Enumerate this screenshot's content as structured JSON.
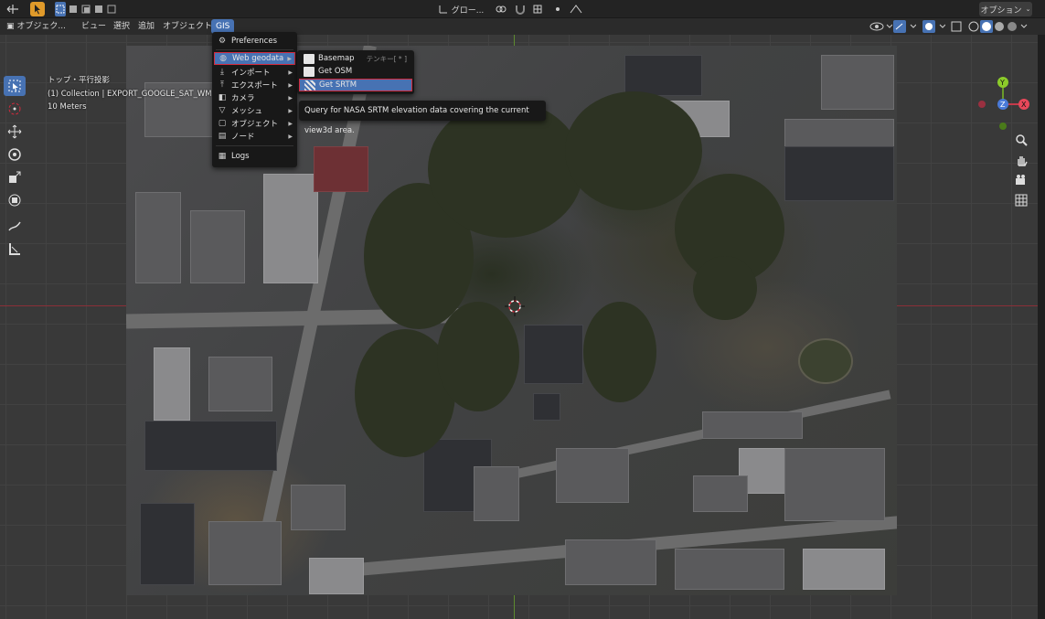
{
  "topbar": {
    "mode_icon": "object-mode-icon",
    "orientation_label": "グロー...",
    "options_label": "オプション"
  },
  "header": {
    "menus": [
      "オブジェク...",
      "ビュー",
      "選択",
      "追加",
      "オブジェクト",
      "GIS"
    ]
  },
  "viewport": {
    "view_name": "トップ・平行投影",
    "collection": "(1) Collection | EXPORT_GOOGLE_SAT_WM",
    "scale": "10 Meters"
  },
  "gis_menu": {
    "items": [
      {
        "label": "Preferences",
        "icon": "gear-icon",
        "submenu": false
      },
      {
        "label": "Web geodata",
        "icon": "globe-icon",
        "submenu": true
      },
      {
        "label": "インポート",
        "icon": "import-icon",
        "submenu": true
      },
      {
        "label": "エクスポート",
        "icon": "export-icon",
        "submenu": true
      },
      {
        "label": "カメラ",
        "icon": "camera-icon",
        "submenu": true
      },
      {
        "label": "メッシュ",
        "icon": "mesh-icon",
        "submenu": true
      },
      {
        "label": "オブジェクト",
        "icon": "object-icon",
        "submenu": true
      },
      {
        "label": "ノード",
        "icon": "node-icon",
        "submenu": true
      },
      {
        "label": "Logs",
        "icon": "log-icon",
        "submenu": false
      }
    ]
  },
  "web_geodata_menu": {
    "items": [
      {
        "label": "Basemap",
        "shortcut": "テンキー[ * ]"
      },
      {
        "label": "Get OSM",
        "shortcut": ""
      },
      {
        "label": "Get SRTM",
        "shortcut": ""
      }
    ]
  },
  "tooltip": {
    "text": "Query for NASA SRTM elevation data covering the current view3d area."
  },
  "gizmo": {
    "y_label": "Y",
    "z_label": "Z",
    "x_label": "X"
  },
  "colors": {
    "accent": "#4772b3",
    "highlight_border": "#d22a3c",
    "active_tool": "#e09a2a"
  }
}
